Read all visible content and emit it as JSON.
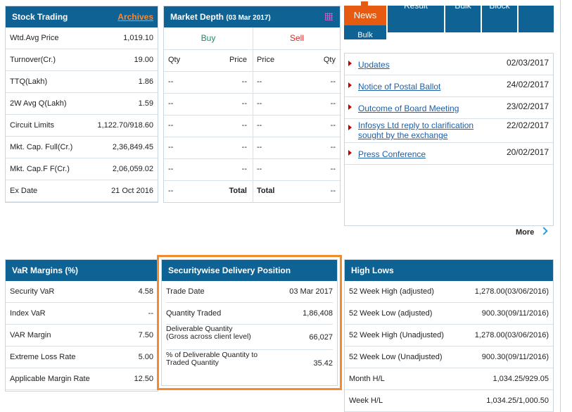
{
  "stock_trading": {
    "title": "Stock Trading",
    "archives_label": "Archives",
    "rows": [
      {
        "label": "Wtd.Avg Price",
        "value": "1,019.10"
      },
      {
        "label": "Turnover(Cr.)",
        "value": "19.00"
      },
      {
        "label": "TTQ(Lakh)",
        "value": "1.86"
      },
      {
        "label": "2W Avg Q(Lakh)",
        "value": "1.59"
      },
      {
        "label": "Circuit Limits",
        "value": "1,122.70/918.60"
      },
      {
        "label": "Mkt. Cap. Full(Cr.)",
        "value": "2,36,849.45"
      },
      {
        "label": "Mkt. Cap.F F(Cr.)",
        "value": "2,06,059.02"
      },
      {
        "label": "Ex Date",
        "value": "21 Oct 2016"
      }
    ]
  },
  "market_depth": {
    "title": "Market Depth",
    "date": "(03 Mar 2017)",
    "buy_label": "Buy",
    "sell_label": "Sell",
    "col_qty": "Qty",
    "col_price": "Price",
    "dash": "--",
    "total_label": "Total",
    "buy_color": "#1a8a6a",
    "sell_color": "#e21f1f"
  },
  "news": {
    "tabs": [
      "News",
      "Result",
      "Bulk",
      "Bulk",
      "Block"
    ],
    "items": [
      {
        "title": "Updates",
        "date": "02/03/2017"
      },
      {
        "title": "Notice of Postal Ballot",
        "date": "24/02/2017"
      },
      {
        "title": "Outcome of Board Meeting",
        "date": "23/02/2017"
      },
      {
        "title": "Infosys Ltd reply to clarification sought by the exchange",
        "date": "22/02/2017"
      },
      {
        "title": "Press Conference",
        "date": "20/02/2017"
      }
    ],
    "more_label": "More"
  },
  "var_margins": {
    "title": "VaR Margins (%)",
    "rows": [
      {
        "label": "Security VaR",
        "value": "4.58"
      },
      {
        "label": "Index VaR",
        "value": "--"
      },
      {
        "label": "VAR Margin",
        "value": "7.50"
      },
      {
        "label": "Extreme Loss Rate",
        "value": "5.00"
      },
      {
        "label": "Applicable Margin Rate",
        "value": "12.50"
      }
    ]
  },
  "delivery": {
    "title": "Securitywise Delivery Position",
    "trade_date_label": "Trade Date",
    "trade_date_value": "03 Mar 2017",
    "qty_traded_label": "Quantity Traded",
    "qty_traded_value": "1,86,408",
    "deliverable_label_1": "Deliverable Quantity",
    "deliverable_label_2": "(Gross across client level)",
    "deliverable_value": "66,027",
    "pct_label_1": "% of Deliverable Quantity to",
    "pct_label_2": "Traded Quantity",
    "pct_value": "35.42",
    "highlight_color": "#f58a2c"
  },
  "high_lows": {
    "title": "High Lows",
    "rows": [
      {
        "label": "52 Week High (adjusted)",
        "value": "1,278.00(03/06/2016)"
      },
      {
        "label": "52 Week Low (adjusted)",
        "value": "900.30(09/11/2016)"
      },
      {
        "label": "52 Week High (Unadjusted)",
        "value": "1,278.00(03/06/2016)"
      },
      {
        "label": "52 Week Low (Unadjusted)",
        "value": "900.30(09/11/2016)"
      },
      {
        "label": "Month H/L",
        "value": "1,034.25/929.05"
      },
      {
        "label": "Week H/L",
        "value": "1,034.25/1,000.50"
      }
    ]
  }
}
